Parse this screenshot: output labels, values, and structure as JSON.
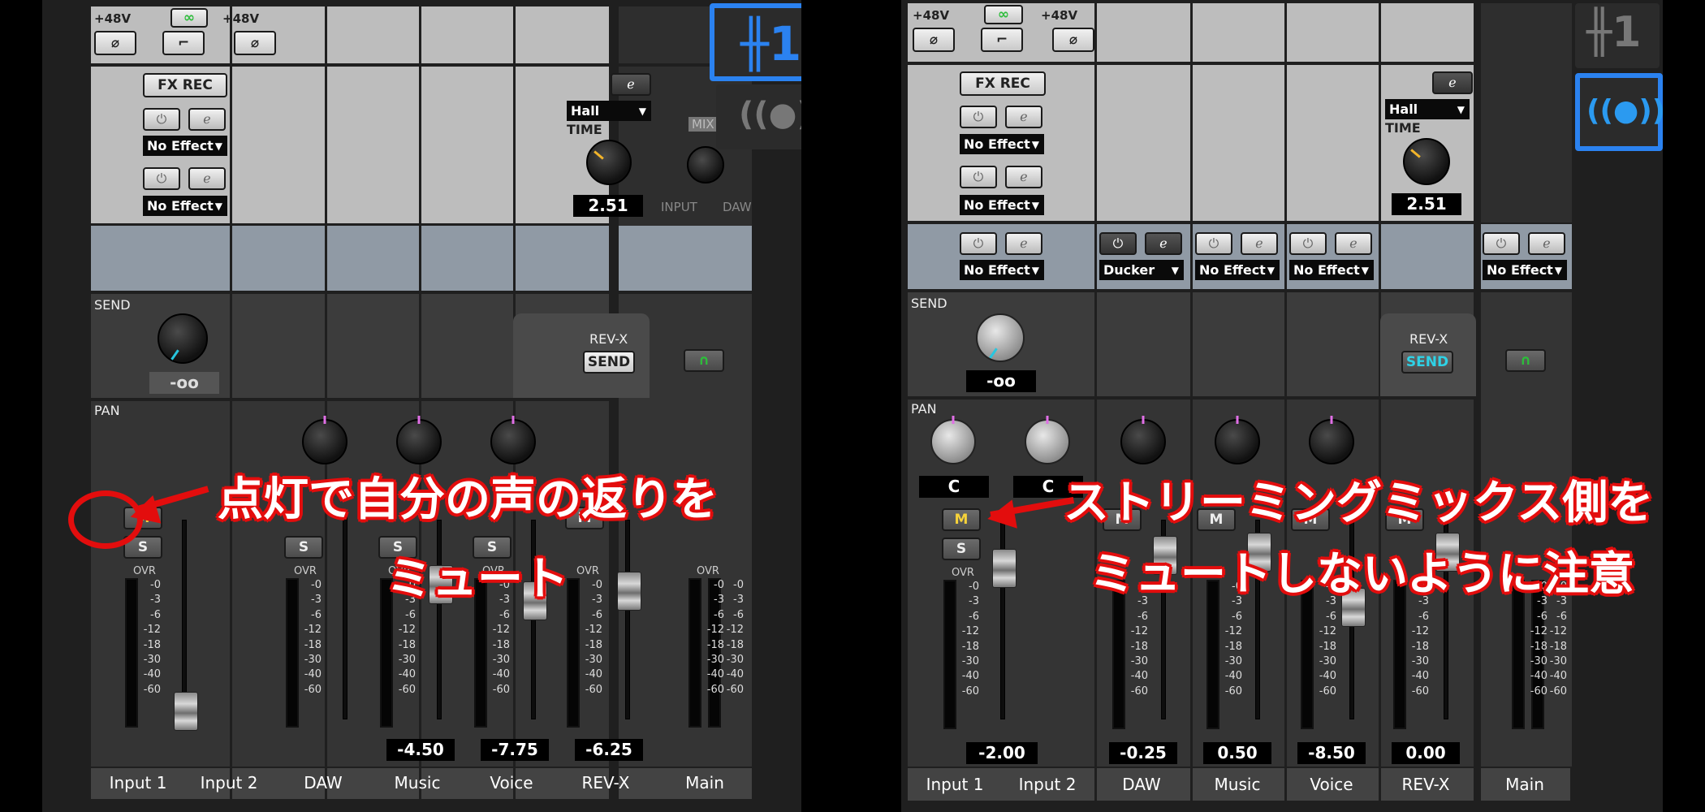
{
  "left": {
    "phantom_label_a": "+48V",
    "phantom_label_b": "+48V",
    "fx_rec": "FX REC",
    "no_effect": "No Effect",
    "reverb_type": "Hall",
    "time_label": "TIME",
    "time_value": "2.51",
    "mix_label": "MIX",
    "input_label": "INPUT",
    "daw_label": "DAW",
    "send_label": "SEND",
    "send_value": "-oo",
    "rev_x_label": "REV-X",
    "send_btn": "SEND",
    "pan_label": "PAN",
    "mute": "M",
    "solo": "S",
    "ovr": "OVR",
    "scale": [
      "0",
      "3",
      "6",
      "12",
      "18",
      "30",
      "40",
      "60"
    ],
    "fader_values": {
      "music": "-4.50",
      "voice": "-7.75",
      "revx": "-6.25"
    },
    "channels": [
      "Input 1",
      "Input 2",
      "DAW",
      "Music",
      "Voice",
      "REV-X",
      "Main"
    ],
    "callout_line1": "点灯で自分の声の返りを",
    "callout_line2": "ミュート"
  },
  "right": {
    "phantom_label_a": "+48V",
    "phantom_label_b": "+48V",
    "fx_rec": "FX REC",
    "no_effect": "No Effect",
    "ducker": "Ducker",
    "reverb_type": "Hall",
    "time_label": "TIME",
    "time_value": "2.51",
    "send_label": "SEND",
    "send_value": "-oo",
    "rev_x_label": "REV-X",
    "send_btn": "SEND",
    "pan_label": "PAN",
    "pan_c": "C",
    "mute": "M",
    "solo": "S",
    "ovr": "OVR",
    "scale": [
      "0",
      "3",
      "6",
      "12",
      "18",
      "30",
      "40",
      "60"
    ],
    "fader_values": {
      "input": "-2.00",
      "daw": "-0.25",
      "music": "0.50",
      "voice": "-8.50",
      "revx": "0.00"
    },
    "channels": [
      "Input 1",
      "Input 2",
      "DAW",
      "Music",
      "Voice",
      "REV-X",
      "Main"
    ],
    "callout_line1": "ストリーミングミックス側を",
    "callout_line2": "ミュートしないように注意"
  },
  "colors": {
    "accent_blue": "#2b82f0",
    "callout_red": "#e30d0d",
    "mute_yellow": "#f6d23a",
    "pan_indicator": "#e06fe6"
  },
  "icons": [
    "mixer-1-icon",
    "streaming-icon",
    "link-icon",
    "phase-icon",
    "highpass-icon",
    "power-icon",
    "edit-icon",
    "headphone-icon"
  ]
}
